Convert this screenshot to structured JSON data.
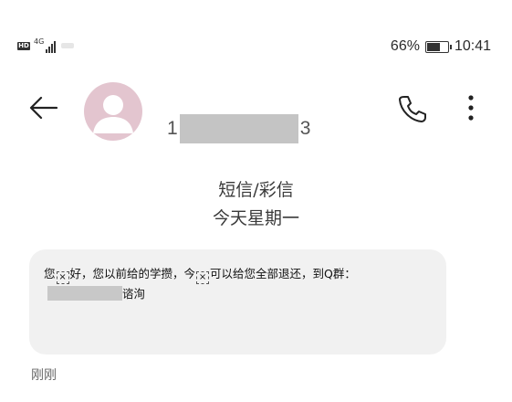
{
  "status_bar": {
    "hd_label": "HD",
    "network_type": "4G",
    "battery_percent_text": "66%",
    "battery_level": 0.66,
    "time": "10:41"
  },
  "header": {
    "contact_number_prefix": "1",
    "contact_number_suffix": "3"
  },
  "conversation": {
    "message_type": "短信/彩信",
    "date_label": "今天星期一"
  },
  "message": {
    "part1": "您",
    "placeholder_glyph": "×",
    "part2": "好，您以前给的学攒，今",
    "part3": "可以给您全部退还，到Q群：",
    "part4": "谘洵",
    "timestamp": "刚刚"
  },
  "colors": {
    "avatar_bg": "#e3c5cf",
    "bubble_bg": "#f1f1f1",
    "redaction": "#c4c4c4"
  }
}
